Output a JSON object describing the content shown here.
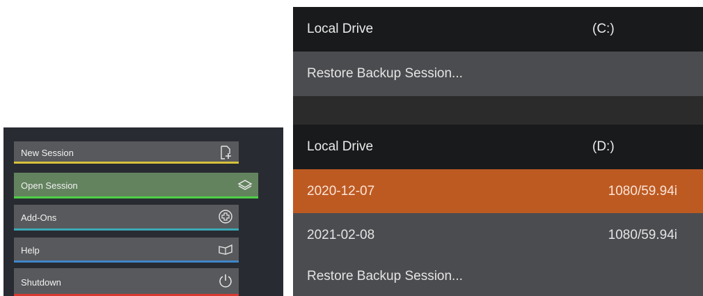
{
  "menu": {
    "items": [
      {
        "label": "New Session",
        "icon": "new-session-icon",
        "underline": "#d7c13b"
      },
      {
        "label": "Open Session",
        "icon": "layers-icon",
        "underline": "#4fd047"
      },
      {
        "label": "Add-Ons",
        "icon": "plus-circle-icon",
        "underline": "#3aaab8"
      },
      {
        "label": "Help",
        "icon": "book-icon",
        "underline": "#3f86c9"
      },
      {
        "label": "Shutdown",
        "icon": "power-icon",
        "underline": "#d8392f"
      }
    ],
    "open_session_bg": "#63835f"
  },
  "drives": [
    {
      "name": "Local Drive",
      "letter": "(C:)",
      "restore_label": "Restore Backup Session..."
    },
    {
      "name": "Local Drive",
      "letter": "(D:)",
      "sessions": [
        {
          "date": "2020-12-07",
          "format": "1080/59.94i",
          "selected": true
        },
        {
          "date": "2021-02-08",
          "format": "1080/59.94i",
          "selected": false
        }
      ],
      "restore_label": "Restore Backup Session..."
    }
  ],
  "colors": {
    "selected_row": "#bd5a22",
    "header_row": "#191a1c",
    "item_row": "#4b4c4f"
  }
}
